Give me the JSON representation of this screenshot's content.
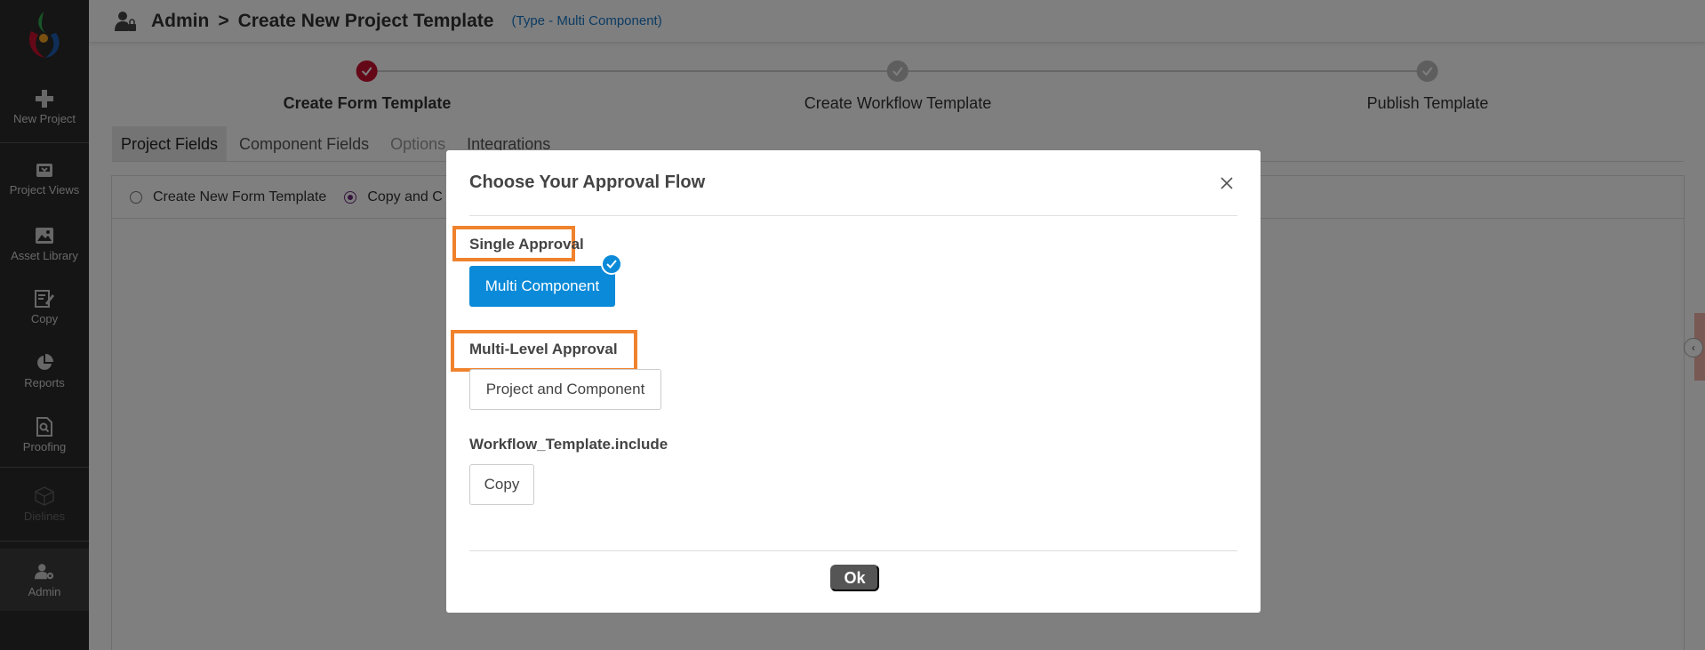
{
  "sidebar": {
    "items": [
      {
        "label": "New Project",
        "icon": "plus-icon"
      },
      {
        "label": "Project Views",
        "icon": "inbox-icon"
      },
      {
        "label": "Asset Library",
        "icon": "image-icon"
      },
      {
        "label": "Copy",
        "icon": "edit-icon"
      },
      {
        "label": "Reports",
        "icon": "pie-chart-icon"
      },
      {
        "label": "Proofing",
        "icon": "search-doc-icon"
      },
      {
        "label": "Dielines",
        "icon": "cube-icon"
      },
      {
        "label": "Admin",
        "icon": "user-gear-icon"
      }
    ]
  },
  "header": {
    "crumb_root": "Admin",
    "separator": ">",
    "crumb_current": "Create New Project Template",
    "type_note": "(Type - Multi Component)"
  },
  "stepper": {
    "steps": [
      {
        "label": "Create Form Template",
        "done": true
      },
      {
        "label": "Create Workflow Template",
        "done": false
      },
      {
        "label": "Publish Template",
        "done": false
      }
    ]
  },
  "tabs": [
    {
      "label": "Project Fields"
    },
    {
      "label": "Component Fields"
    },
    {
      "label": "Options"
    },
    {
      "label": "Integrations"
    }
  ],
  "form": {
    "option_new": "Create New Form Template",
    "option_copy": "Copy and C"
  },
  "modal": {
    "title": "Choose Your Approval Flow",
    "single_label": "Single Approval",
    "single_button": "Multi Component",
    "multi_label": "Multi-Level Approval",
    "multi_button": "Project and Component",
    "include_label": "Workflow_Template.include",
    "copy_button": "Copy",
    "ok_button": "Ok"
  },
  "colors": {
    "accent": "#0a8ad8",
    "highlight": "#f0822d",
    "step_done": "#c8102e",
    "sidebar_bg": "#2b2b2b"
  }
}
